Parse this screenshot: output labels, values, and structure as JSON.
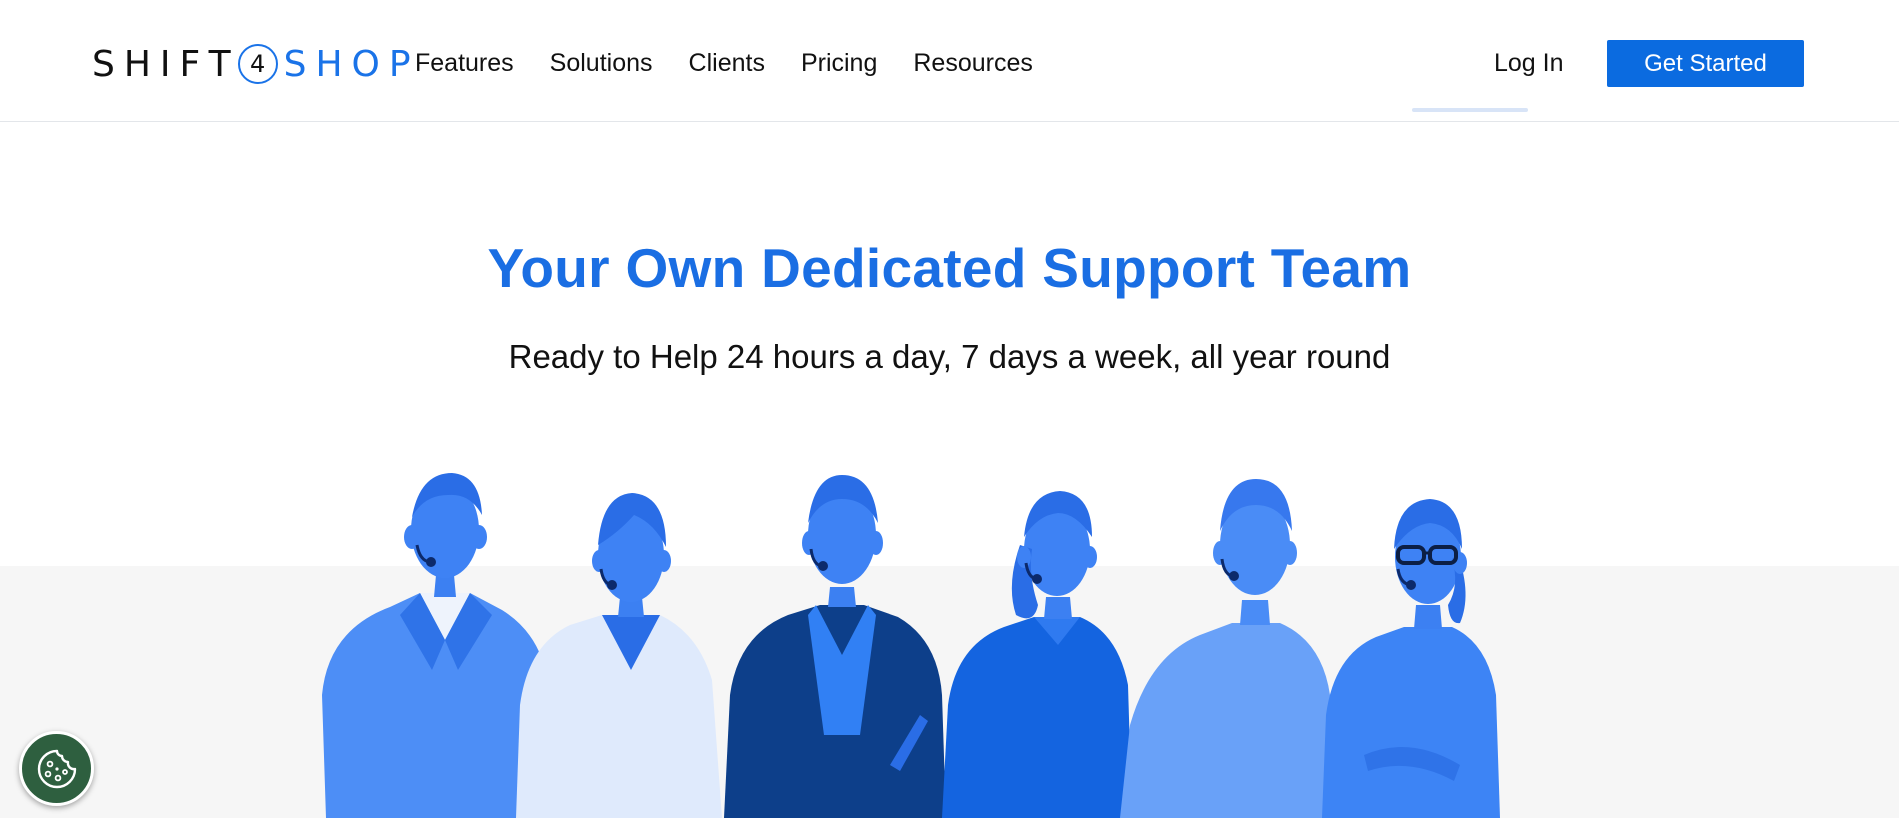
{
  "brand": {
    "logo_left": "SHIFT",
    "logo_digit": "4",
    "logo_right": "SHOP",
    "accent_color": "#1a73e8"
  },
  "nav": {
    "items": [
      "Features",
      "Solutions",
      "Clients",
      "Pricing",
      "Resources"
    ],
    "login_label": "Log In",
    "cta_label": "Get Started",
    "cta_color": "#0b6be0"
  },
  "hero": {
    "title": "Your Own Dedicated Support Team",
    "subtitle": "Ready to Help 24 hours a day, 7 days a week, all year round",
    "title_color": "#1a6ee3"
  },
  "illustration": {
    "icon": "support-team-illustration"
  },
  "cookie_button": {
    "icon": "cookie-icon",
    "color": "#2e5f3f"
  }
}
